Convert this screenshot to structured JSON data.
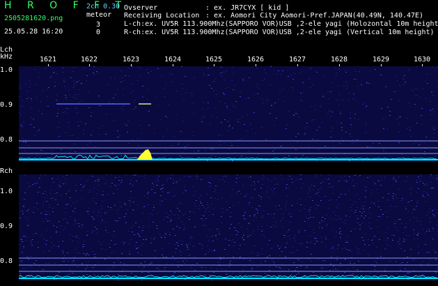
{
  "header": {
    "app_logo": "H R O F F T",
    "version": "2ch 0.30",
    "filename": "2505281620.png",
    "meteor_label": "meteor",
    "lch_count": "3",
    "datetime": "25.05.28 16:20",
    "rch_count": "0",
    "observer_label": "Ovserver",
    "observer_value": ": ex. JR7CYX [ kid ]",
    "location_label": "Receiving Location",
    "location_value": ": ex. Aomori City Aomori-Pref.JAPAN(40.49N, 140.47E)",
    "lch_info": "L-ch:ex. UV5R 113.900Mhz(SAPPORO VOR)USB ,2-ele yagi (Holozontal 10m height",
    "rch_info": "R-ch:ex. UV5R 113.900Mhz(SAPPORO VOR)USB ,2-ele yagi (Vertical 10m height)"
  },
  "axis": {
    "lch_label": "Lch",
    "unit_label": "kHz",
    "rch_label": "Rch",
    "freq_ticks": [
      "1621",
      "1622",
      "1623",
      "1624",
      "1625",
      "1626",
      "1627",
      "1628",
      "1629",
      "1630"
    ],
    "lch_y_ticks": [
      "1.0",
      "0.9",
      "0.8"
    ],
    "rch_y_ticks": [
      "1.0",
      "0.9",
      "0.8"
    ]
  },
  "colors": {
    "background": "#000000",
    "waterfall_base": "#0a0a40",
    "spectrum_line": "#00e5ff",
    "meteor_peak": "#ffff33",
    "grid_line": "#8899ff",
    "logo_green": "#33ff66"
  }
}
